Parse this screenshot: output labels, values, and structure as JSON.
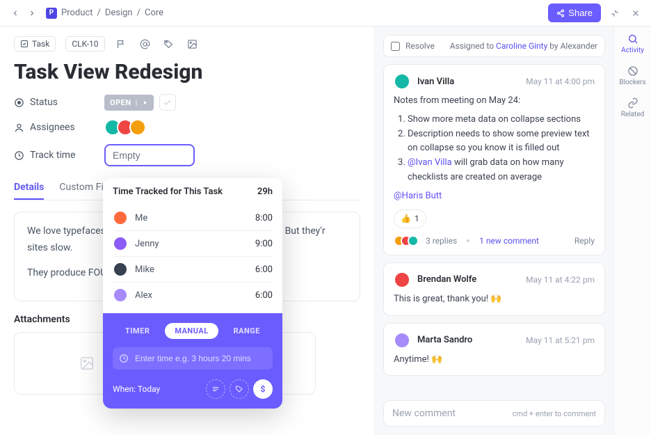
{
  "breadcrumb": {
    "p": "P",
    "a": "Product",
    "b": "Design",
    "c": "Core"
  },
  "topbar": {
    "share": "Share"
  },
  "meta": {
    "taskLabel": "Task",
    "taskId": "CLK-10"
  },
  "title": "Task View Redesign",
  "fields": {
    "statusLabel": "Status",
    "statusValue": "OPEN",
    "assigneesLabel": "Assignees",
    "trackLabel": "Track time",
    "trackValue": "Empty"
  },
  "tabs": {
    "details": "Details",
    "custom": "Custom Fie"
  },
  "description": {
    "p1": "We love typefaces.                                                                  d feel. They convey the inf                                                                     ion hierarchy. But they'r                                                                         sites slow.",
    "p2": "They produce FOU                                                                   table ways. Why should v                                                                       n the"
  },
  "attachmentsHeading": "Attachments",
  "tracker": {
    "heading": "Time Tracked for This Task",
    "total": "29h",
    "rows": [
      {
        "name": "Me",
        "time": "8:00",
        "color": "#ff6a3d"
      },
      {
        "name": "Jenny",
        "time": "9:00",
        "color": "#8b5cf6"
      },
      {
        "name": "Mike",
        "time": "6:00",
        "color": "#374151"
      },
      {
        "name": "Alex",
        "time": "6:00",
        "color": "#a78bfa"
      }
    ],
    "seg": {
      "timer": "TIMER",
      "manual": "MANUAL",
      "range": "RANGE"
    },
    "placeholder": "Enter time e.g. 3 hours 20 mins",
    "when": "When: Today",
    "dollar": "$"
  },
  "resolve": {
    "label": "Resolve",
    "assignedPrefix": "Assigned to ",
    "assignee": "Caroline Ginty",
    "by": " by Alexander"
  },
  "comments": [
    {
      "author": "Ivan Villa",
      "avatarColor": "#14b8a6",
      "ts": "May 11 at 4:00 pm",
      "lead": "Notes from meeting on May 24:",
      "items": [
        "Show more meta data on collapse sections",
        "Description needs to show some preview text on collapse so you know it is filled out"
      ],
      "mentionItem": {
        "mention": "@Ivan Villa",
        "rest": " will grab data on how many checklists are created on average"
      },
      "tail": "@Haris Butt",
      "reaction": {
        "emoji": "👍",
        "count": "1"
      },
      "replies": "3 replies",
      "newc": "1 new comment",
      "reply": "Reply"
    },
    {
      "author": "Brendan Wolfe",
      "avatarColor": "#ef4444",
      "ts": "May 11 at 4:22 pm",
      "text": "This is great, thank you! 🙌"
    },
    {
      "author": "Marta Sandro",
      "avatarColor": "#a78bfa",
      "ts": "May 11 at 5:21 pm",
      "text": "Anytime! 🙌"
    }
  ],
  "composer": {
    "placeholder": "New comment",
    "hint": "cmd + enter to comment"
  },
  "rail": {
    "activity": "Activity",
    "blockers": "Blockers",
    "related": "Related"
  }
}
